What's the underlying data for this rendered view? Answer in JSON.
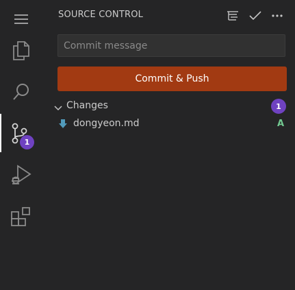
{
  "activity_bar": {
    "items": [
      {
        "name": "menu",
        "icon": "hamburger-menu-icon"
      },
      {
        "name": "explorer",
        "icon": "files-icon"
      },
      {
        "name": "search",
        "icon": "search-icon"
      },
      {
        "name": "source-control",
        "icon": "source-control-icon",
        "badge": "1",
        "active": true
      },
      {
        "name": "run-debug",
        "icon": "run-debug-icon"
      },
      {
        "name": "extensions",
        "icon": "extensions-icon"
      }
    ]
  },
  "sidebar": {
    "title": "SOURCE CONTROL",
    "toolbar_icons": [
      "view-as-tree-icon",
      "check-icon",
      "more-actions-icon"
    ],
    "commit": {
      "placeholder": "Commit message",
      "value": "",
      "button_label": "Commit & Push",
      "button_color": "#a23a12"
    },
    "changes": {
      "label": "Changes",
      "count": "1",
      "files": [
        {
          "name": "dongyeon.md",
          "status": "A",
          "icon": "markdown-file-icon"
        }
      ]
    }
  },
  "colors": {
    "background": "#252526",
    "badge": "#6f42c1",
    "added": "#73c991"
  }
}
